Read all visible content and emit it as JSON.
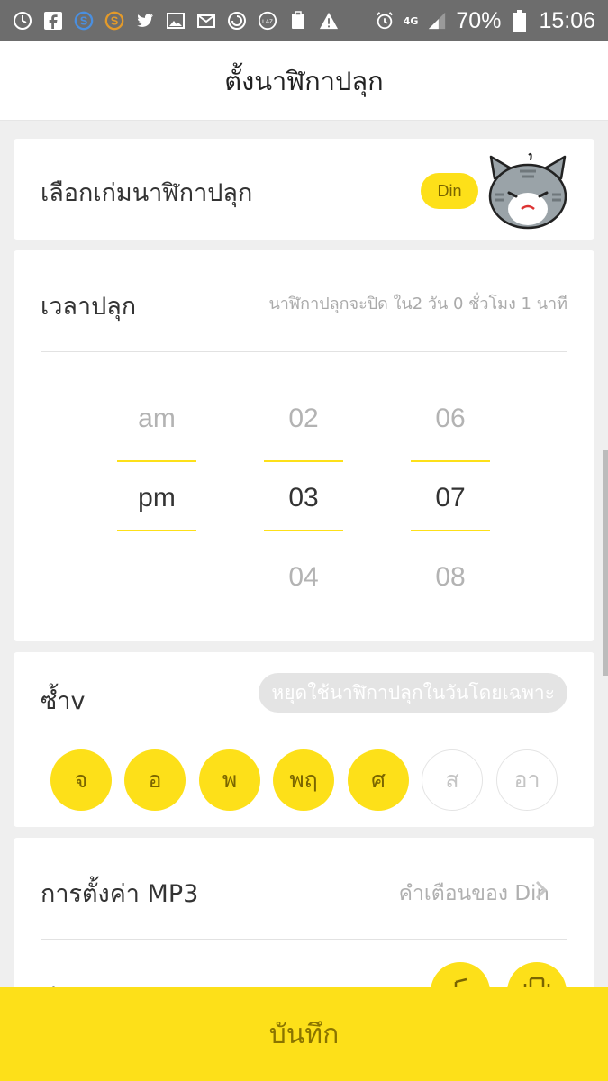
{
  "status_bar": {
    "battery": "70%",
    "time": "15:06",
    "network": "4G",
    "left_icons": [
      "timer-icon",
      "facebook-icon",
      "skype-icon",
      "s-app-icon",
      "twitter-icon",
      "gallery-icon",
      "mail-icon",
      "sync-icon",
      "lazada-icon",
      "clipboard-icon",
      "warning-icon"
    ]
  },
  "app_bar": {
    "title": "ตั้งนาฬิกาปลุก"
  },
  "theme": {
    "label": "เลือกเก่มนาฬิกาปลุก",
    "badge": "Din"
  },
  "time": {
    "label": "เวลาปลุก",
    "note": "นาฬิกาปลุกจะปิด ใน2 วัน 0 ชั่วโมง 1 นาที",
    "ampm": {
      "above": "am",
      "selected": "pm"
    },
    "hour": {
      "above": "02",
      "selected": "03",
      "below": "04"
    },
    "minute": {
      "above": "06",
      "selected": "07",
      "below": "08"
    }
  },
  "repeat": {
    "label": "ซ้ำv",
    "skip_button": "หยุดใช้นาฬิกาปลุกในวันโดยเฉพาะ",
    "days": [
      {
        "label": "จ",
        "active": true
      },
      {
        "label": "อ",
        "active": true
      },
      {
        "label": "พ",
        "active": true
      },
      {
        "label": "พฤ",
        "active": true
      },
      {
        "label": "ศ",
        "active": true
      },
      {
        "label": "ส",
        "active": false
      },
      {
        "label": "อา",
        "active": false
      }
    ]
  },
  "mp3": {
    "label": "การตั้งค่า MP3",
    "value": "คำเตือนของ Din"
  },
  "type": {
    "label": "ประเภท"
  },
  "save": {
    "label": "บันทึก"
  },
  "colors": {
    "accent": "#fde019",
    "status_bar": "#6d6d6d",
    "background": "#efefef"
  }
}
